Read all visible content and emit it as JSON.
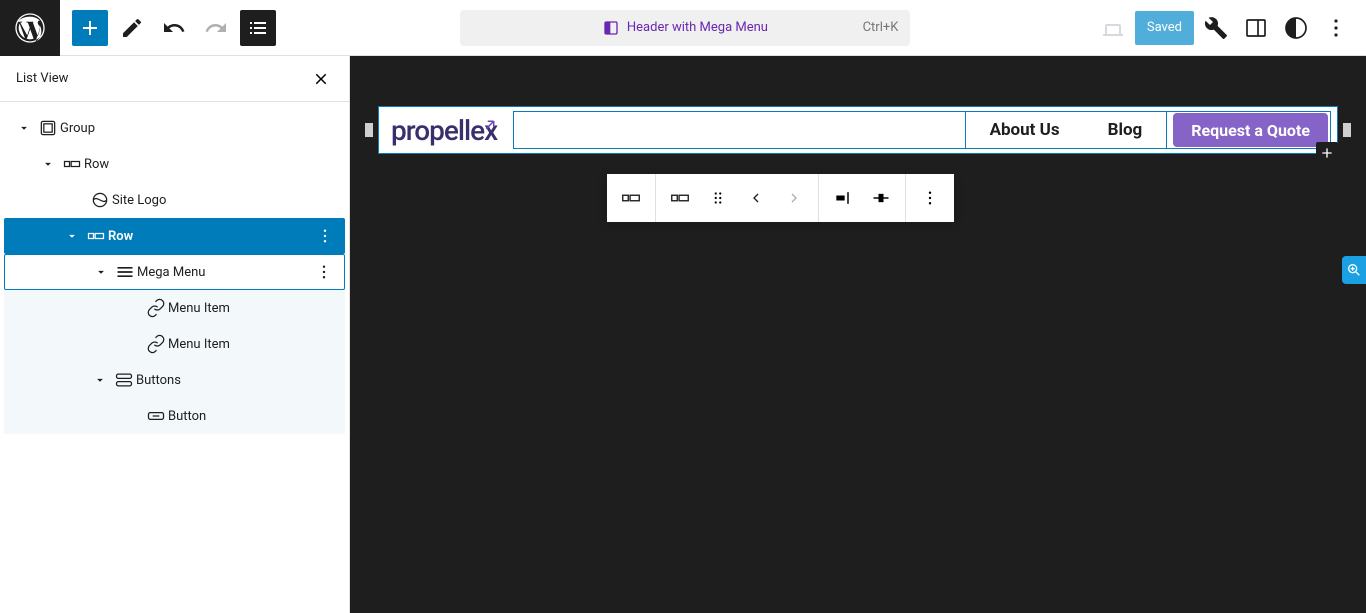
{
  "topbar": {
    "template_label": "Header with Mega Menu",
    "shortcut": "Ctrl+K",
    "saved_label": "Saved"
  },
  "sidebar": {
    "title": "List View",
    "items": {
      "group": "Group",
      "row1": "Row",
      "site_logo": "Site Logo",
      "row2": "Row",
      "mega_menu": "Mega Menu",
      "menu_item1": "Menu Item",
      "menu_item2": "Menu Item",
      "buttons": "Buttons",
      "button": "Button"
    }
  },
  "canvas": {
    "logo_text": "propellex",
    "nav": {
      "about": "About Us",
      "blog": "Blog"
    },
    "cta": "Request a Quote"
  }
}
